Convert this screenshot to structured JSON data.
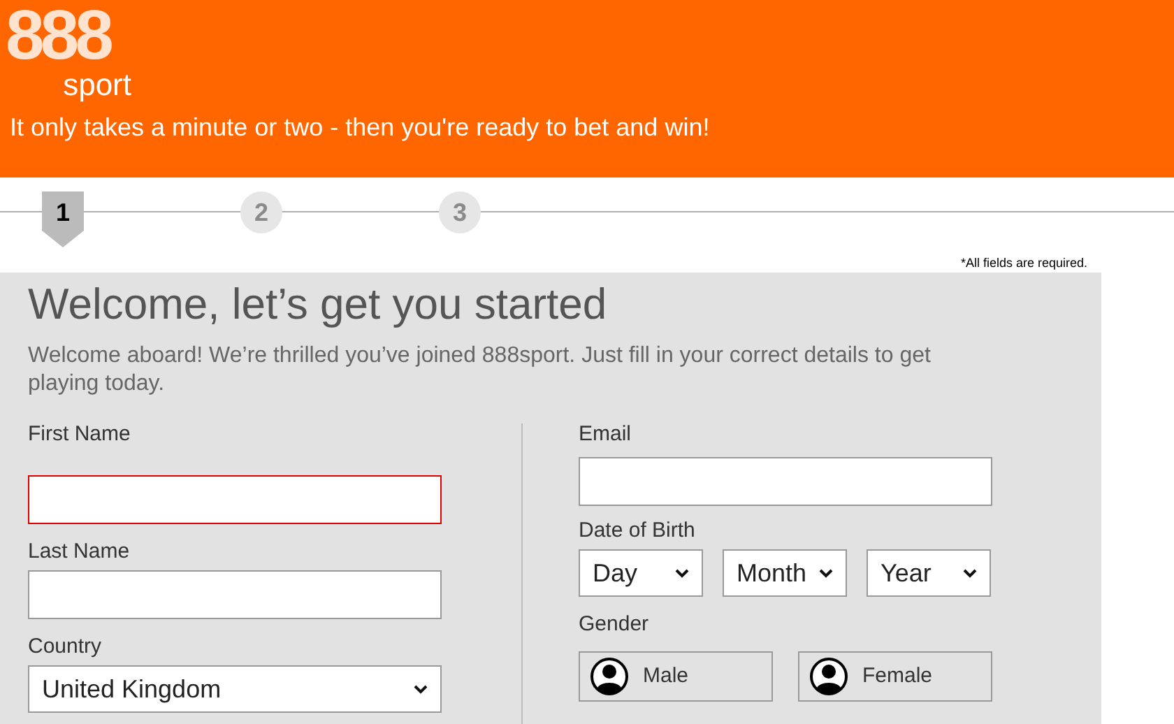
{
  "header": {
    "logo_digits": "888",
    "logo_word": "sport",
    "tagline": "It only takes a minute or two - then you're ready to bet and win!"
  },
  "steps": [
    {
      "label": "1",
      "selected": true
    },
    {
      "label": "2",
      "selected": false
    },
    {
      "label": "3",
      "selected": false
    }
  ],
  "required_note": "*All fields are required.",
  "form": {
    "title": "Welcome, let’s get you started",
    "intro": "Welcome aboard! We’re thrilled you’ve joined 888sport. Just fill in your correct details to get playing today.",
    "first_name": {
      "label": "First Name",
      "invalid": true
    },
    "last_name": {
      "label": "Last Name",
      "invalid": false
    },
    "country": {
      "label": "Country",
      "value": "United Kingdom"
    },
    "email": {
      "label": "Email",
      "invalid": false
    },
    "date_of_birth": {
      "label": "Date of Birth",
      "selects": [
        "Day",
        "Month",
        "Year"
      ]
    },
    "gender": {
      "label": "Gender",
      "options": [
        {
          "label": "Male",
          "selected": false
        },
        {
          "label": "Female",
          "selected": false
        }
      ]
    }
  }
}
